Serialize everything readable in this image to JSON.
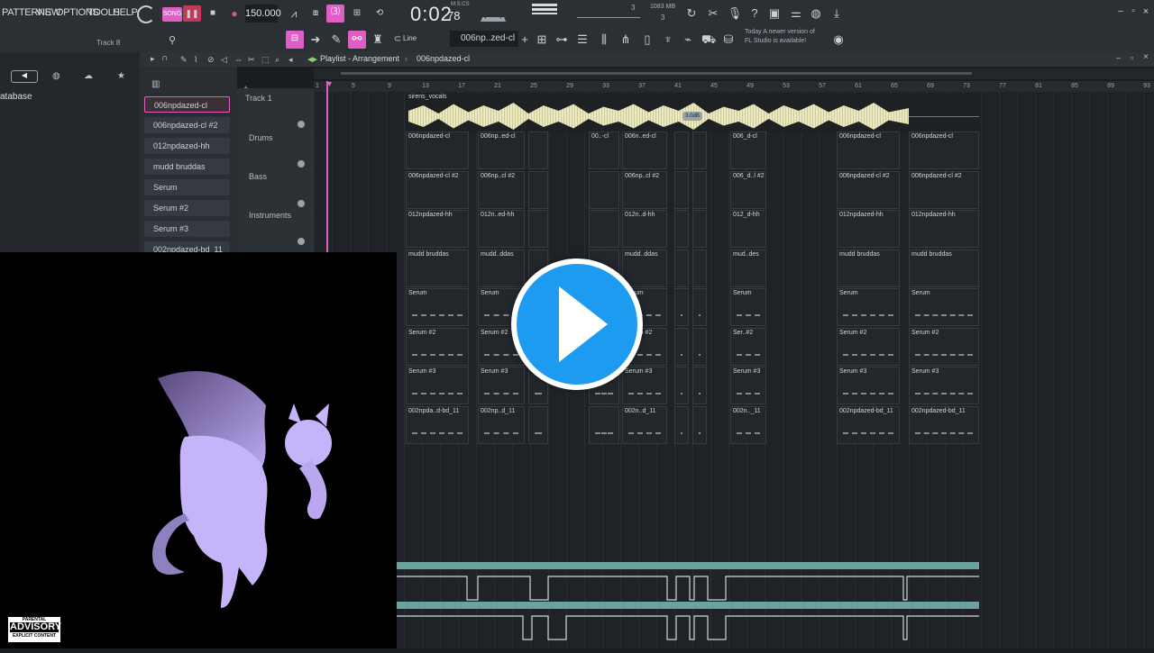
{
  "menu": {
    "items": [
      "PATTERNS",
      "VIEW",
      "OPTIONS",
      "TOOLS",
      "HELP"
    ]
  },
  "transport": {
    "tempo": "150.000",
    "time": "0:02",
    "time_sub": "78",
    "time_label": "M:S:CS",
    "mem": "1083 MB",
    "mem_sub": "3",
    "pattern_num": "3",
    "mode": "SONG"
  },
  "toolbar": {
    "snap_label": "Line",
    "pattern_selector": "006np..zed-cl",
    "news_line1": "Today  A newer version of",
    "news_line2": "FL Studio is available!"
  },
  "browser": {
    "label": "atabase",
    "track_label": "Track 8"
  },
  "playlist": {
    "title": "Playlist - Arrangement",
    "pattern": "006npdazed-cl",
    "track1": "Track 1"
  },
  "channels": [
    "006npdazed-cl",
    "006npdazed-cl #2",
    "012npdazed-hh",
    "mudd bruddas",
    "Serum",
    "Serum #2",
    "Serum #3",
    "002npdazed-bd_11"
  ],
  "tracks": [
    "Drums",
    "Bass",
    "Instruments"
  ],
  "ruler": [
    "1",
    "5",
    "9",
    "13",
    "17",
    "21",
    "25",
    "29",
    "33",
    "37",
    "41",
    "45",
    "49",
    "53",
    "57",
    "61",
    "65",
    "69",
    "73",
    "77",
    "81",
    "85",
    "89",
    "93"
  ],
  "audio_clip": {
    "name": "sirens_vocals",
    "gain": "3.0dB"
  },
  "clip_rows": [
    {
      "labels": [
        "006npdazed-cl",
        "006np..ed-cl",
        "",
        "00..-cl",
        "006n..ed-cl",
        "",
        "",
        "006_d-cl",
        "006npdazed-cl",
        "006npdazed-cl"
      ]
    },
    {
      "labels": [
        "006npdazed-cl #2",
        "006np..cl #2",
        "",
        "",
        "006np..cl #2",
        "",
        "",
        "006_d..l #2",
        "006npdazed-cl #2",
        "006npdazed-cl #2"
      ]
    },
    {
      "labels": [
        "012npdazed-hh",
        "012n..ed-hh",
        "",
        "",
        "012n..d-hh",
        "",
        "",
        "012_d-hh",
        "012npdazed-hh",
        "012npdazed-hh"
      ]
    },
    {
      "labels": [
        "mudd bruddas",
        "mudd..ddas",
        "",
        "",
        "mudd..ddas",
        "",
        "",
        "mud..des",
        "mudd bruddas",
        "mudd bruddas"
      ]
    },
    {
      "labels": [
        "Serum",
        "Serum",
        "",
        "",
        "Serum",
        "",
        "",
        "Serum",
        "Serum",
        "Serum"
      ]
    },
    {
      "labels": [
        "Serum #2",
        "Serum #2",
        "",
        "",
        "Serum #2",
        "",
        "",
        "Ser..#2",
        "Serum #2",
        "Serum #2"
      ]
    },
    {
      "labels": [
        "Serum #3",
        "Serum #3",
        "",
        "",
        "Serum #3",
        "",
        "",
        "Serum #3",
        "Serum #3",
        "Serum #3"
      ]
    },
    {
      "labels": [
        "002npda..d-bd_11",
        "002np..d_11",
        "",
        "",
        "002n..d_11",
        "",
        "",
        "002n.._11",
        "002npdazed-bd_11",
        "002npdazed-bd_11"
      ]
    }
  ],
  "badge": {
    "line1": "PARENTAL",
    "line2": "ADVISORY",
    "line3": "EXPLICIT CONTENT"
  },
  "colors": {
    "accent": "#e05fc6",
    "play": "#1d9bf0",
    "wave": "#ece9c2",
    "automation": "#6aa3a0"
  }
}
